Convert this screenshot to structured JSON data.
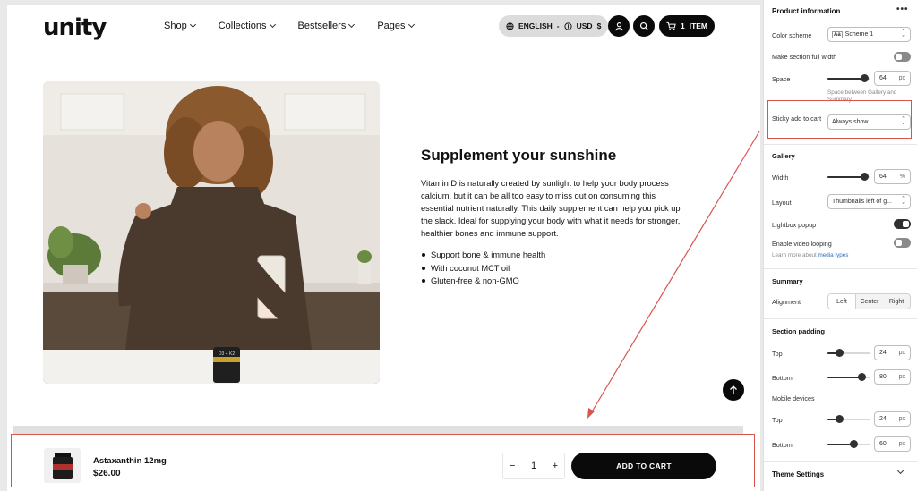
{
  "store": {
    "logo": "unity",
    "nav": [
      {
        "label": "Shop"
      },
      {
        "label": "Collections"
      },
      {
        "label": "Bestsellers"
      },
      {
        "label": "Pages"
      }
    ],
    "language": "ENGLISH",
    "separator": "-",
    "currency": "USD",
    "currency_symbol": "$",
    "cart_count": "1",
    "cart_label": "ITEM"
  },
  "section": {
    "headline": "Supplement your sunshine",
    "description": "Vitamin D is naturally created by sunlight to help your body process calcium, but it can be all too easy to miss out on consuming this essential nutrient naturally. This daily supplement can help you pick up the slack. Ideal for supplying your body with what it needs for stronger, healthier bones and immune support.",
    "bullets": [
      "Support bone & immune health",
      "With coconut MCT oil",
      "Gluten-free & non-GMO"
    ],
    "jar_label": "D3 + K2"
  },
  "sticky_bar": {
    "product_name": "Astaxanthin 12mg",
    "price": "$26.00",
    "qty_minus": "−",
    "qty_value": "1",
    "qty_plus": "+",
    "add_to_cart": "ADD TO CART"
  },
  "panel": {
    "title": "Product information",
    "more": "•••",
    "color_scheme_label": "Color scheme",
    "color_scheme_swatch": "Aa",
    "color_scheme_value": "Scheme 1",
    "full_width_label": "Make section full width",
    "full_width": false,
    "space_label": "Space",
    "space_value": "64",
    "space_unit": "px",
    "space_fraction": 0.85,
    "space_hint": "Space between Gallery and Summary",
    "sticky_label": "Sticky add to cart",
    "sticky_value": "Always show",
    "gallery_heading": "Gallery",
    "width_label": "Width",
    "width_value": "64",
    "width_unit": "%",
    "width_fraction": 0.85,
    "layout_label": "Layout",
    "layout_value": "Thumbnails left of g...",
    "lightbox_label": "Lightbox popup",
    "lightbox": true,
    "video_loop_label": "Enable video looping",
    "video_loop": false,
    "learn_more_prefix": "Learn more about",
    "learn_more_link": "media types",
    "summary_heading": "Summary",
    "alignment_label": "Alignment",
    "alignment_options": [
      "Left",
      "Center",
      "Right"
    ],
    "alignment_selected": "Left",
    "padding_heading": "Section padding",
    "top_label": "Top",
    "top_value": "24",
    "top_fraction": 0.28,
    "bottom_label": "Bottom",
    "bottom_value": "80",
    "bottom_fraction": 0.8,
    "mobile_heading": "Mobile devices",
    "m_top_label": "Top",
    "m_top_value": "24",
    "m_top_fraction": 0.28,
    "m_bottom_label": "Bottom",
    "m_bottom_value": "60",
    "m_bottom_fraction": 0.6,
    "unit_px": "px",
    "theme_settings": "Theme Settings"
  },
  "colors": {
    "accent_black": "#0a0a0a",
    "annotation_red": "#d9534f",
    "link_blue": "#2c6ecb"
  }
}
